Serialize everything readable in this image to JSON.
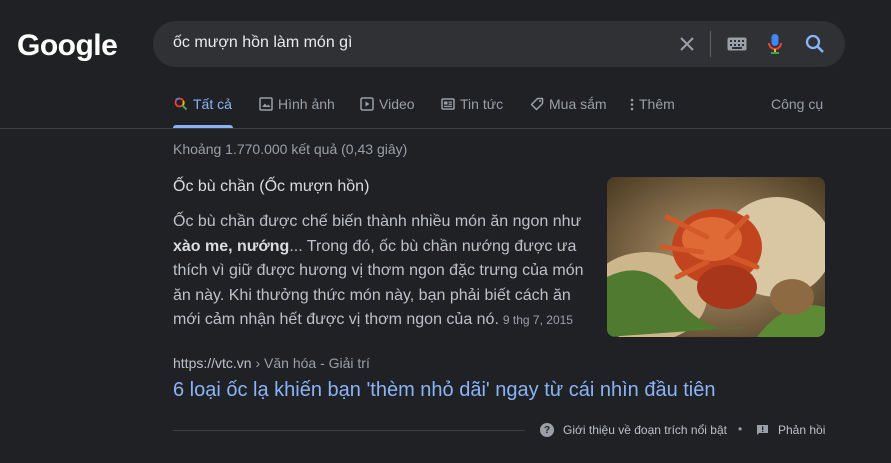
{
  "logo": "Google",
  "search": {
    "query": "ốc mượn hồn làm món gì"
  },
  "tabs": [
    {
      "label": "Tất cả",
      "icon": "search-icon",
      "active": true
    },
    {
      "label": "Hình ảnh",
      "icon": "image-icon"
    },
    {
      "label": "Video",
      "icon": "video-icon"
    },
    {
      "label": "Tin tức",
      "icon": "news-icon"
    },
    {
      "label": "Mua sắm",
      "icon": "tag-icon"
    },
    {
      "label": "Thêm",
      "icon": "more-vert-icon"
    }
  ],
  "tools_label": "Công cụ",
  "stats": "Khoảng 1.770.000 kết quả (0,43 giây)",
  "featured_snippet": {
    "title": "Ốc bù chần (Ốc mượn hồn)",
    "text_before": "Ốc bù chần được chế biến thành nhiều món ăn ngon như ",
    "text_bold": "xào me, nướng",
    "text_after": "... Trong đó, ốc bù chần nướng được ưa thích vì giữ được hương vị thơm ngon đặc trưng của món ăn này. Khi thưởng thức món này, bạn phải biết cách ăn mới cảm nhận hết được vị thơm ngon của nó.",
    "date": "9 thg 7, 2015"
  },
  "result": {
    "domain": "https://vtc.vn",
    "breadcrumb": " › Văn hóa - Giải trí",
    "title": "6 loại ốc lạ khiến bạn 'thèm nhỏ dãi' ngay từ cái nhìn đầu tiên"
  },
  "footer": {
    "about_label": "Giới thiệu về đoạn trích nổi bật",
    "separator": "•",
    "feedback_label": "Phản hồi"
  },
  "colors": {
    "background": "#202124",
    "link": "#8ab4f8",
    "search_box": "#303134"
  }
}
